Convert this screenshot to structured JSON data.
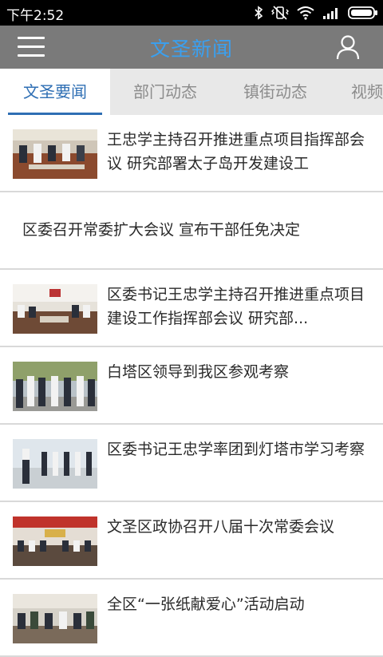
{
  "status": {
    "time": "下午2:52"
  },
  "header": {
    "title": "文圣新闻"
  },
  "tabs": [
    {
      "label": "文圣要闻",
      "active": true
    },
    {
      "label": "部门动态",
      "active": false
    },
    {
      "label": "镇街动态",
      "active": false
    },
    {
      "label": "视频",
      "active": false
    }
  ],
  "news": [
    {
      "title": "王忠学主持召开推进重点项目指挥部会议 研究部署太子岛开发建设工",
      "has_image": true
    },
    {
      "title": "区委召开常委扩大会议 宣布干部任免决定",
      "has_image": false
    },
    {
      "title": "区委书记王忠学主持召开推进重点项目建设工作指挥部会议 研究部...",
      "has_image": true
    },
    {
      "title": "白塔区领导到我区参观考察",
      "has_image": true
    },
    {
      "title": "区委书记王忠学率团到灯塔市学习考察",
      "has_image": true
    },
    {
      "title": "文圣区政协召开八届十次常委会议",
      "has_image": true
    },
    {
      "title": "全区“一张纸献爱心”活动启动",
      "has_image": true
    }
  ],
  "colors": {
    "accent": "#2f6fb4",
    "title_blue": "#3aa0f0",
    "appbar": "#7a7a7a"
  }
}
